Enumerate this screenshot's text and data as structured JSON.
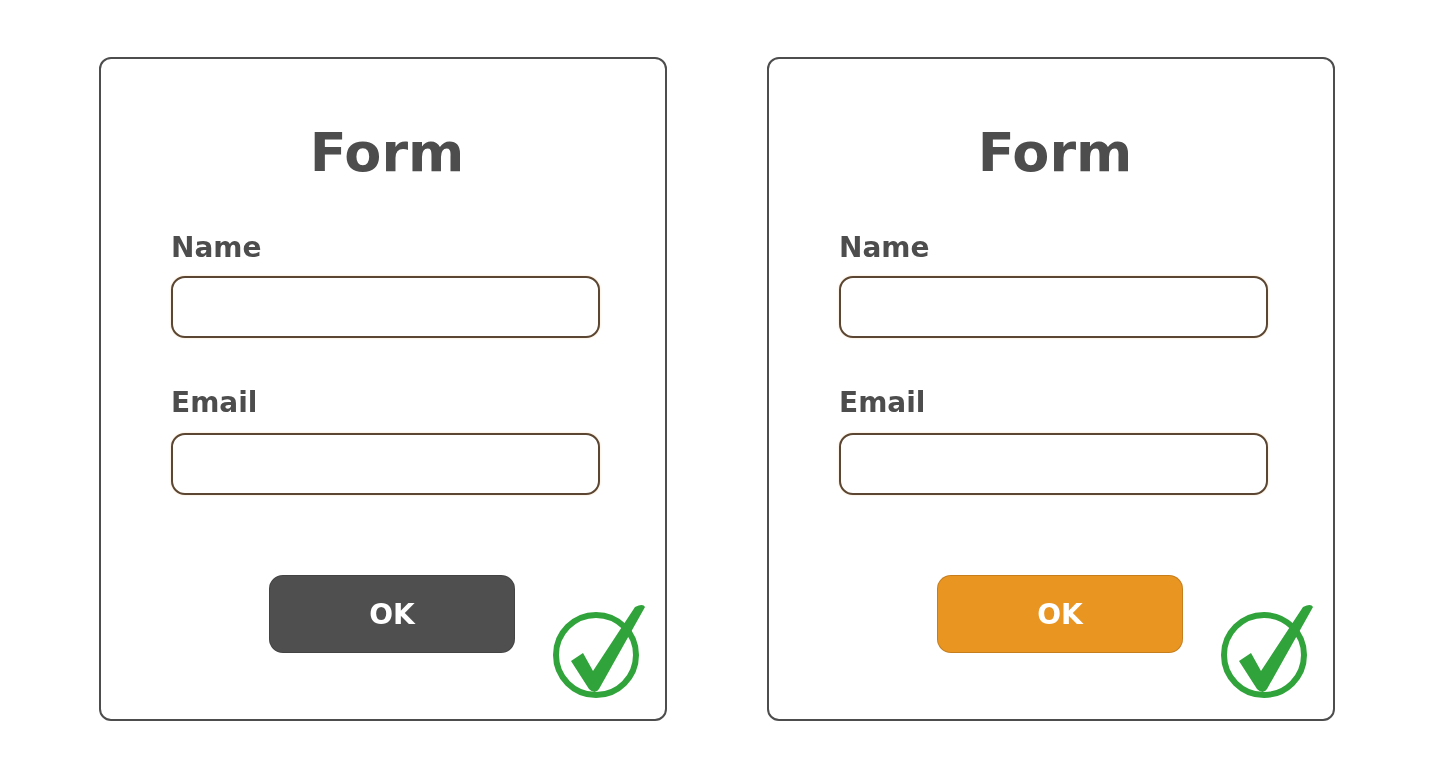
{
  "forms": [
    {
      "title": "Form",
      "fields": [
        {
          "label": "Name"
        },
        {
          "label": "Email"
        }
      ],
      "button": {
        "label": "OK",
        "color": "#4f4f4f"
      }
    },
    {
      "title": "Form",
      "fields": [
        {
          "label": "Name"
        },
        {
          "label": "Email"
        }
      ],
      "button": {
        "label": "OK",
        "color": "#e99522"
      }
    }
  ]
}
